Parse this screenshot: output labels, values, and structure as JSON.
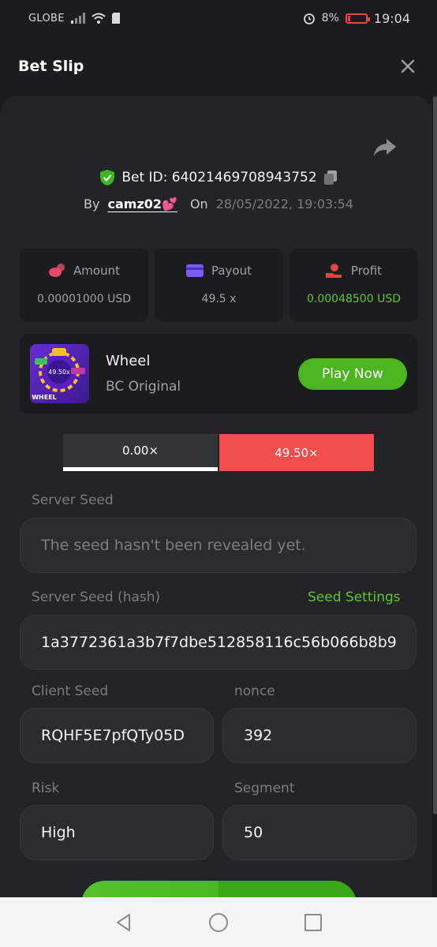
{
  "status_bar": {
    "carrier": "GLOBE",
    "battery_percent": "8%",
    "time": "19:04",
    "icons": [
      "signal-icon",
      "wifi-icon",
      "sim-icon",
      "alarm-icon",
      "battery-low-icon"
    ]
  },
  "header": {
    "title": "Bet Slip",
    "close_icon": "close-icon"
  },
  "bet": {
    "id_label": "Bet ID: 64021469708943752",
    "by_label": "By",
    "username": "camz02💕",
    "on_label": "On",
    "date": "28/05/2022, 19:03:54"
  },
  "stats": {
    "amount": {
      "label": "Amount",
      "value": "0.00001000 USD",
      "icon": "coins-icon",
      "color": "#e8476a"
    },
    "payout": {
      "label": "Payout",
      "value": "49.5 x",
      "icon": "wallet-icon",
      "color": "#7a5cf5"
    },
    "profit": {
      "label": "Profit",
      "value": "0.00048500 USD",
      "icon": "hand-money-icon",
      "color": "#e0453f"
    }
  },
  "game": {
    "name": "Wheel",
    "provider": "BC Original",
    "thumb_text": "WHEEL",
    "thumb_multiplier": "49.50x",
    "play_label": "Play Now"
  },
  "payout_bar": {
    "left": "0.00×",
    "right": "49.50×"
  },
  "fields": {
    "server_seed_label": "Server Seed",
    "server_seed_value": "The seed hasn't been revealed yet.",
    "server_hash_label": "Server Seed (hash)",
    "seed_settings_label": "Seed Settings",
    "server_hash_value": "1a3772361a3b7f7dbe512858116c56b066b8b9",
    "client_seed_label": "Client Seed",
    "client_seed_value": "RQHF5E7pfQTy05D",
    "nonce_label": "nonce",
    "nonce_value": "392",
    "risk_label": "Risk",
    "risk_value": "High",
    "segment_label": "Segment",
    "segment_value": "50"
  },
  "colors": {
    "accent_green": "#4ab51f",
    "profit_green": "#62c52f",
    "lose_red": "#f24d4d",
    "panel": "#232427"
  }
}
